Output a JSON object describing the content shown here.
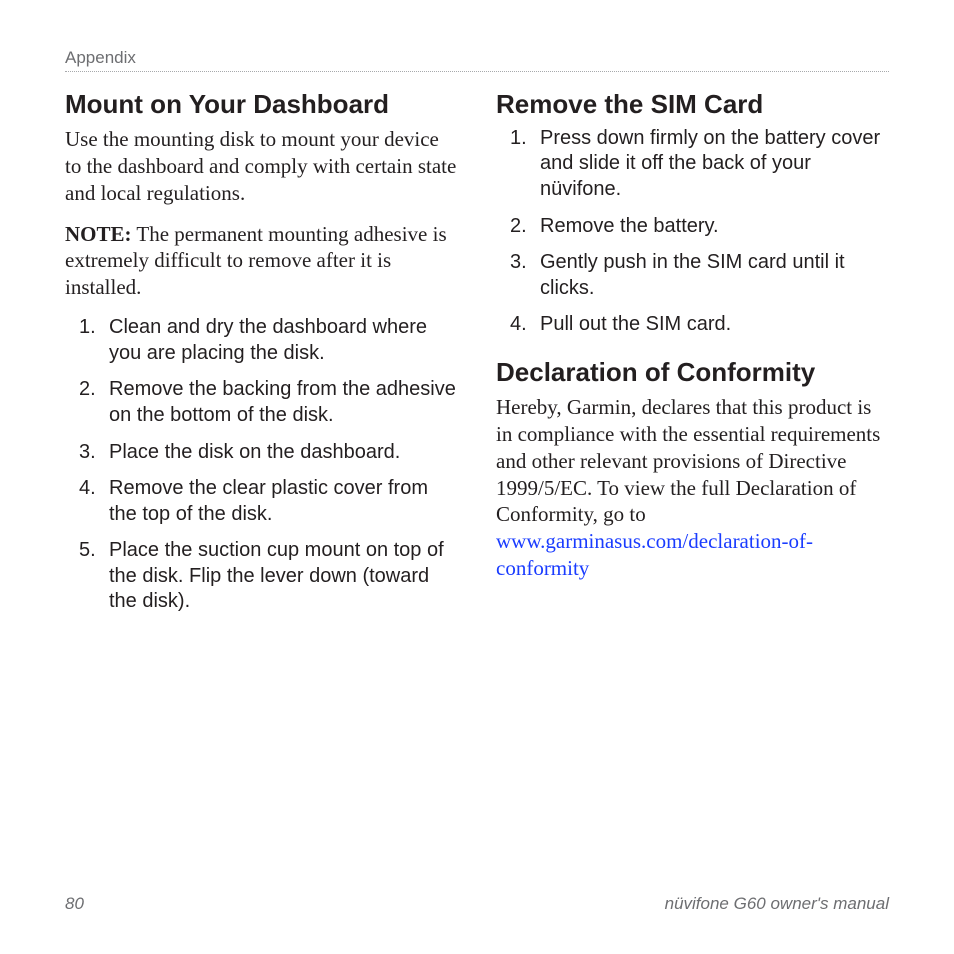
{
  "header": {
    "section_label": "Appendix"
  },
  "left": {
    "heading_mount": "Mount on Your Dashboard",
    "mount_intro": "Use the mounting disk to mount your device to the dashboard and comply with certain state and local regulations.",
    "note_label": "NOTE:",
    "note_body": " The permanent mounting adhesive is extremely difficult to remove after it is installed.",
    "mount_steps": [
      "Clean and dry the dashboard where you are placing the disk.",
      "Remove the backing from the adhesive on the bottom of the disk.",
      "Place the disk on the dashboard.",
      "Remove the clear plastic cover from the top of the disk.",
      "Place the suction cup mount on top of the disk. Flip the lever down (toward the disk)."
    ]
  },
  "right": {
    "heading_sim": "Remove the SIM Card",
    "sim_steps": [
      "Press down firmly on the battery cover and slide it off the back of your nüvifone.",
      "Remove the battery.",
      "Gently push in the SIM card until it clicks.",
      "Pull out the SIM card."
    ],
    "heading_conformity": "Declaration of Conformity",
    "conformity_body": "Hereby, Garmin, declares that this product is in compliance with the essential requirements and other relevant provisions of Directive 1999/5/EC. To view the full Declaration of Conformity, go to ",
    "conformity_link": "www.garminasus.com/declaration-of-conformity"
  },
  "footer": {
    "page_number": "80",
    "manual_title": "nüvifone G60 owner's manual"
  }
}
